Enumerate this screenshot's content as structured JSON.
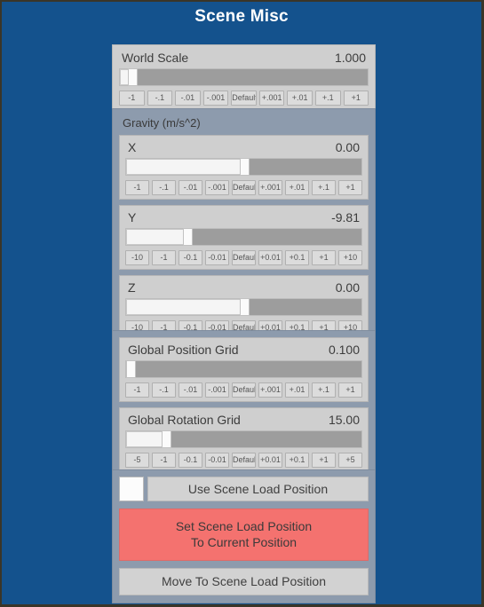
{
  "title": "Scene Misc",
  "colors": {
    "background": "#14528d",
    "panel": "#cfcfcf",
    "group": "#8d9bad",
    "accent_red": "#f4726f",
    "slider_track": "#9d9d9d",
    "slider_fill": "#f5f5f5"
  },
  "steps_small": [
    "-1",
    "-.1",
    "-.01",
    "-.001",
    "Default",
    "+.001",
    "+.01",
    "+.1",
    "+1"
  ],
  "steps_ten": [
    "-10",
    "-1",
    "-0.1",
    "-0.01",
    "Default",
    "+0.01",
    "+0.1",
    "+1",
    "+10"
  ],
  "steps_five": [
    "-5",
    "-1",
    "-0.1",
    "-0.01",
    "Default",
    "+0.01",
    "+0.1",
    "+1",
    "+5"
  ],
  "world_scale": {
    "label": "World Scale",
    "value": "1.000",
    "fill_percent": 4,
    "handle_percent": 5
  },
  "gravity": {
    "group_label": "Gravity (m/s^2)",
    "axes": [
      {
        "label": "X",
        "value": "0.00",
        "fill_percent": 50,
        "handle_percent": 50
      },
      {
        "label": "Y",
        "value": "-9.81",
        "fill_percent": 25,
        "handle_percent": 26
      },
      {
        "label": "Z",
        "value": "0.00",
        "fill_percent": 50,
        "handle_percent": 50
      }
    ]
  },
  "grids": [
    {
      "label": "Global Position Grid",
      "value": "0.100",
      "fill_percent": 1,
      "handle_percent": 2
    },
    {
      "label": "Global Rotation Grid",
      "value": "15.00",
      "fill_percent": 16,
      "handle_percent": 17
    }
  ],
  "actions": {
    "use_scene_load_position": "Use Scene Load Position",
    "checkbox_checked": false,
    "set_scene_load_position": "Set Scene Load Position\nTo Current Position",
    "move_to_scene_load_position": "Move To Scene Load Position"
  }
}
